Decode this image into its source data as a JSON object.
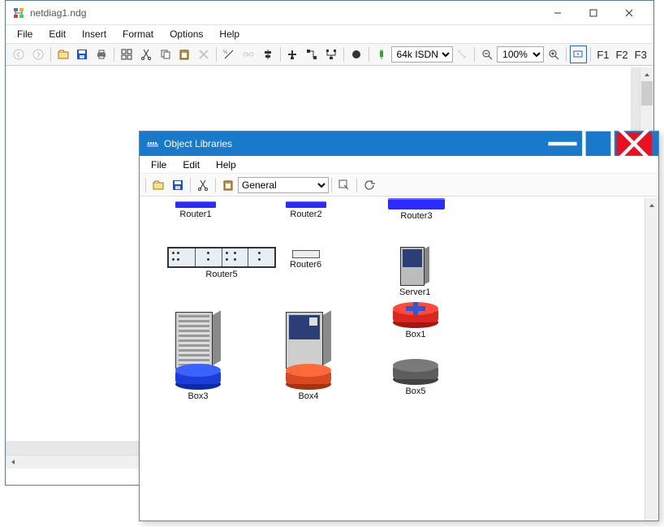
{
  "main": {
    "title": "netdiag1.ndg",
    "menus": [
      "File",
      "Edit",
      "Insert",
      "Format",
      "Options",
      "Help"
    ],
    "link_speed": "64k ISDN",
    "zoom": "100%",
    "fkeys": [
      "F1",
      "F2",
      "F3"
    ]
  },
  "child": {
    "title": "Object Libraries",
    "menus": [
      "File",
      "Edit",
      "Help"
    ],
    "category": "General",
    "items": [
      {
        "label": "Router1"
      },
      {
        "label": "Router2"
      },
      {
        "label": "Router3"
      },
      {
        "label": "Router5"
      },
      {
        "label": "Router6"
      },
      {
        "label": "Server1"
      },
      {
        "label": "Box1"
      },
      {
        "label": "Box3"
      },
      {
        "label": "Box4"
      },
      {
        "label": "Box5"
      }
    ]
  }
}
